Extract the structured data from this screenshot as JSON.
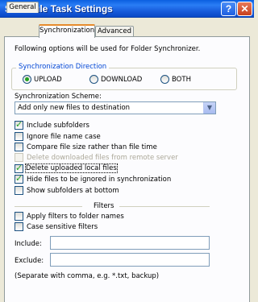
{
  "window": {
    "title": "Schedule Task Settings"
  },
  "tabs": [
    "General",
    "Synchronization",
    "Advanced"
  ],
  "intro_text": "Following options will be used for Folder Synchronizer.",
  "direction": {
    "label": "Synchronization Direction",
    "options": [
      "UPLOAD",
      "DOWNLOAD",
      "BOTH"
    ],
    "selected": "UPLOAD"
  },
  "scheme": {
    "label": "Synchronization Scheme:",
    "value": "Add only new files to destination"
  },
  "options": [
    {
      "label": "Include subfolders",
      "checked": true,
      "disabled": false
    },
    {
      "label": "Ignore file name case",
      "checked": false,
      "disabled": false
    },
    {
      "label": "Compare file size rather than file time",
      "checked": false,
      "disabled": false
    },
    {
      "label": "Delete downloaded files from remote server",
      "checked": false,
      "disabled": true
    },
    {
      "label": "Delete uploaded local files",
      "checked": true,
      "disabled": false
    },
    {
      "label": "Hide files to be ignored in synchronization",
      "checked": true,
      "disabled": false
    },
    {
      "label": "Show subfolders at bottom",
      "checked": false,
      "disabled": false
    }
  ],
  "filters": {
    "label": "Filters",
    "options": [
      {
        "label": "Apply filters to folder names",
        "checked": false
      },
      {
        "label": "Case sensitive filters",
        "checked": false
      }
    ],
    "include_label": "Include:",
    "include_value": "",
    "exclude_label": "Exclude:",
    "exclude_value": "",
    "hint": "(Separate with comma, e.g. *.txt, backup)"
  },
  "colors": {
    "title_bar": "#0a5fe0",
    "accent_tab": "#e68b2c",
    "group_label": "#0046d5",
    "check": "#21a121"
  }
}
